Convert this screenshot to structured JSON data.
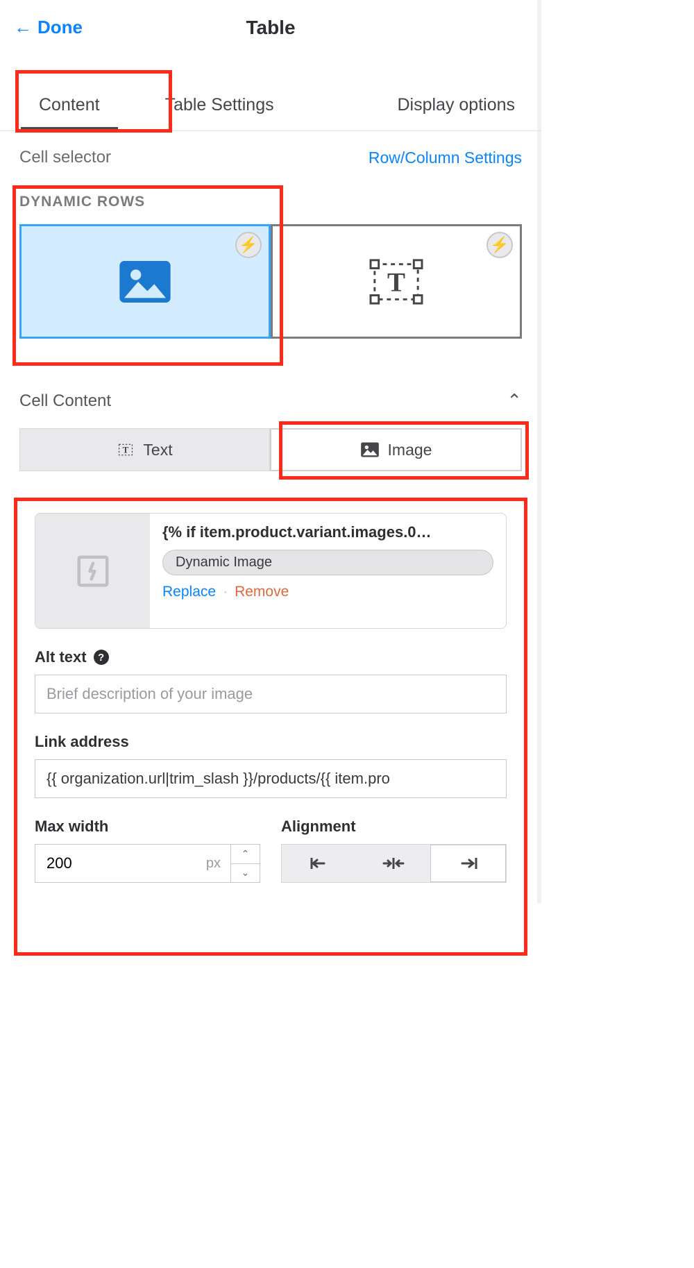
{
  "header": {
    "done": "Done",
    "title": "Table"
  },
  "tabs": {
    "content": "Content",
    "settings": "Table Settings",
    "display": "Display options"
  },
  "cell_selector": {
    "label": "Cell selector",
    "row_col_link": "Row/Column Settings",
    "dynamic_rows": "DYNAMIC ROWS"
  },
  "cell_content": {
    "title": "Cell Content",
    "toggle_text": "Text",
    "toggle_image": "Image"
  },
  "image_form": {
    "title": "{% if item.product.variant.images.0…",
    "pill": "Dynamic Image",
    "replace": "Replace",
    "remove": "Remove",
    "alt_label": "Alt text",
    "alt_placeholder": "Brief description of your image",
    "link_label": "Link address",
    "link_value": "{{ organization.url|trim_slash }}/products/{{ item.pro",
    "maxw_label": "Max width",
    "maxw_value": "200",
    "maxw_unit": "px",
    "align_label": "Alignment"
  }
}
